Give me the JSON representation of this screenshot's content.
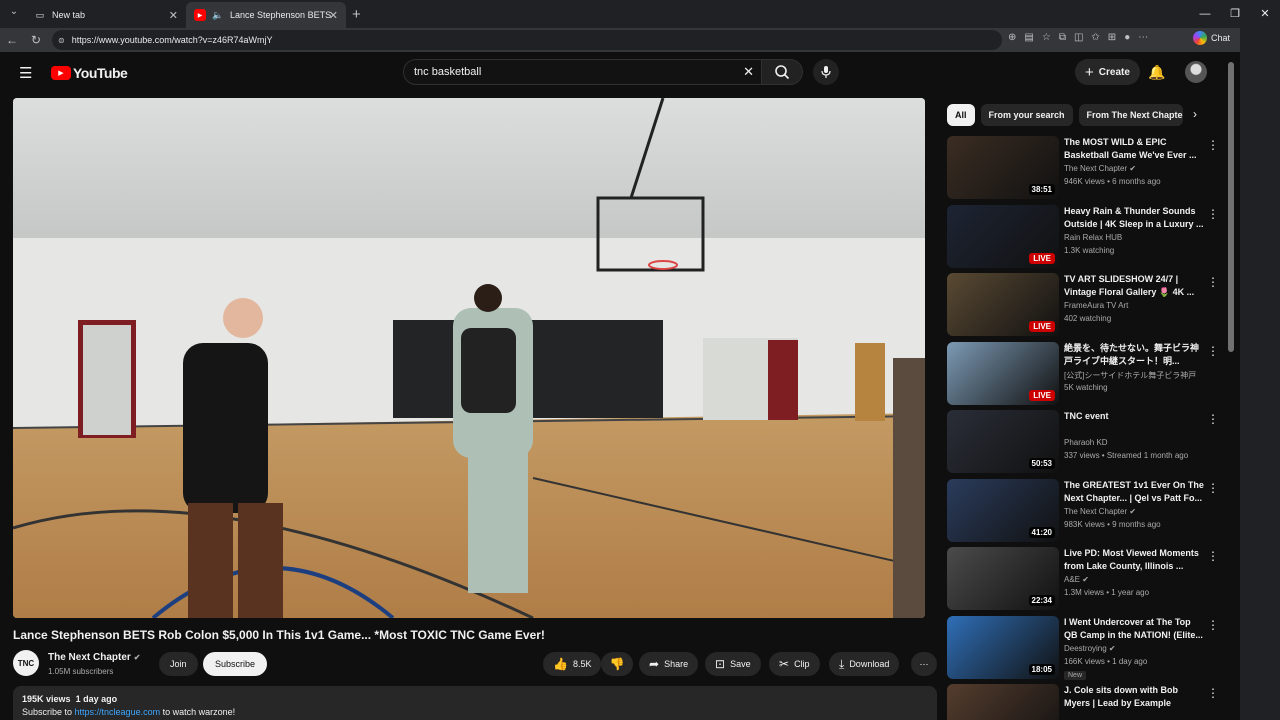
{
  "browser": {
    "tabs": [
      {
        "label": "New tab",
        "icon": "page-icon"
      },
      {
        "label": "Lance Stephenson BETS Rob C",
        "icon": "youtube-icon"
      }
    ],
    "url": "https://www.youtube.com/watch?v=z46R74aWmjY",
    "chat_label": "Chat"
  },
  "header": {
    "logo_text": "YouTube",
    "search_value": "tnc basketball",
    "create_label": "Create"
  },
  "video": {
    "title": "Lance Stephenson BETS Rob Colon $5,000 In This 1v1 Game... *Most TOXIC TNC Game Ever!",
    "channel": "The Next Chapter",
    "channel_avatar_text": "TNC",
    "subscribers": "1.05M subscribers",
    "join_label": "Join",
    "subscribe_label": "Subscribe",
    "likes": "8.5K",
    "share_label": "Share",
    "save_label": "Save",
    "clip_label": "Clip",
    "download_label": "Download",
    "views": "195K views",
    "age": "1 day ago",
    "desc_prefix": "Subscribe to ",
    "desc_link": "https://tncleague.com",
    "desc_suffix": " to watch warzone!"
  },
  "chips": [
    "All",
    "From your search",
    "From The Next Chapter"
  ],
  "recommendations": [
    {
      "title": "The MOST WILD & EPIC Basketball Game We've Ever ...",
      "channel": "The Next Chapter",
      "verified": true,
      "meta": "946K views • 6 months ago",
      "duration": "38:51",
      "thumb": "#3b2d23"
    },
    {
      "title": "Heavy Rain & Thunder Sounds Outside | 4K Sleep in a Luxury ...",
      "channel": "Rain Relax HUB",
      "meta": "1.3K watching",
      "live": "LIVE",
      "thumb": "#1d2433"
    },
    {
      "title": "TV ART SLIDESHOW 24/7 | Vintage Floral Gallery 🌷 4K ...",
      "channel": "FrameAura TV Art",
      "meta": "402 watching",
      "live": "LIVE",
      "thumb": "#5a4a33"
    },
    {
      "title": "絶景を、待たせない。舞子ビラ神戸ライブ中継スタート！明...",
      "channel": "[公式]シーサイドホテル舞子ビラ神戸",
      "meta": "5K watching",
      "live": "LIVE",
      "thumb": "#7c9ab4"
    },
    {
      "title": "TNC event",
      "channel": "Pharaoh KD",
      "meta": "337 views • Streamed 1 month ago",
      "duration": "50:53",
      "thumb": "#2a2e38"
    },
    {
      "title": "The GREATEST 1v1 Ever On The Next Chapter... | Qel vs Patt Fo...",
      "channel": "The Next Chapter",
      "verified": true,
      "meta": "983K views • 9 months ago",
      "duration": "41:20",
      "thumb": "#2a3c5c"
    },
    {
      "title": "Live PD: Most Viewed Moments from Lake County, Illinois ...",
      "channel": "A&E",
      "verified": true,
      "meta": "1.3M views • 1 year ago",
      "duration": "22:34",
      "thumb": "#4b4b4b"
    },
    {
      "title": "I Went Undercover at The Top QB Camp in the NATION! (Elite...",
      "channel": "Deestroying",
      "verified": true,
      "meta": "166K views • 1 day ago",
      "badge": "New",
      "duration": "18:05",
      "thumb": "#2f6fb8"
    },
    {
      "title": "J. Cole sits down with Bob Myers | Lead by Example",
      "channel": "",
      "meta": "",
      "thumb": "#553d2e"
    }
  ]
}
